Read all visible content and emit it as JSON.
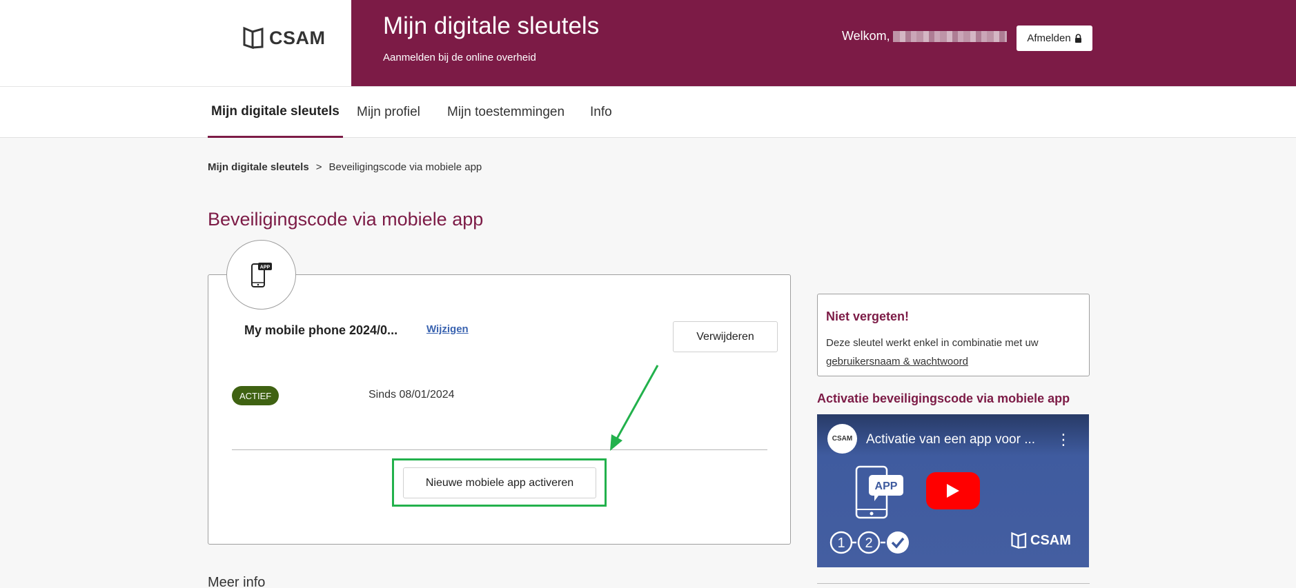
{
  "header": {
    "logo_text": "CSAM",
    "title": "Mijn digitale sleutels",
    "subtitle": "Aanmelden bij de online overheid",
    "welcome": "Welkom,",
    "logout_label": "Afmelden"
  },
  "nav": {
    "tabs": [
      {
        "label": "Mijn digitale sleutels",
        "active": true
      },
      {
        "label": "Mijn profiel"
      },
      {
        "label": "Mijn toestemmingen"
      },
      {
        "label": "Info"
      }
    ]
  },
  "breadcrumb": {
    "root": "Mijn digitale sleutels",
    "separator": ">",
    "current": "Beveiligingscode via mobiele app"
  },
  "page_title": "Beveiligingscode via mobiele app",
  "card": {
    "icon_badge": "APP",
    "device_name": "My mobile phone 2024/0...",
    "change_label": "Wijzigen",
    "delete_label": "Verwijderen",
    "status": "ACTIEF",
    "since": "Sinds 08/01/2024",
    "activate_label": "Nieuwe mobiele app activeren"
  },
  "more_info": "Meer info",
  "sidebar": {
    "notice_title": "Niet vergeten!",
    "notice_text": "Deze sleutel werkt enkel in combinatie met uw",
    "notice_link": "gebruikersnaam & wachtwoord",
    "video_heading": "Activatie beveiligingscode via mobiele app",
    "video": {
      "channel": "CSAM",
      "title": "Activatie van een app voor ...",
      "app_badge": "APP",
      "steps": [
        "1",
        "2"
      ],
      "logo_text": "CSAM"
    }
  },
  "colors": {
    "brand": "#7c1b46",
    "status_active": "#3f6212",
    "highlight": "#22b14c",
    "link": "#3a63b0"
  }
}
